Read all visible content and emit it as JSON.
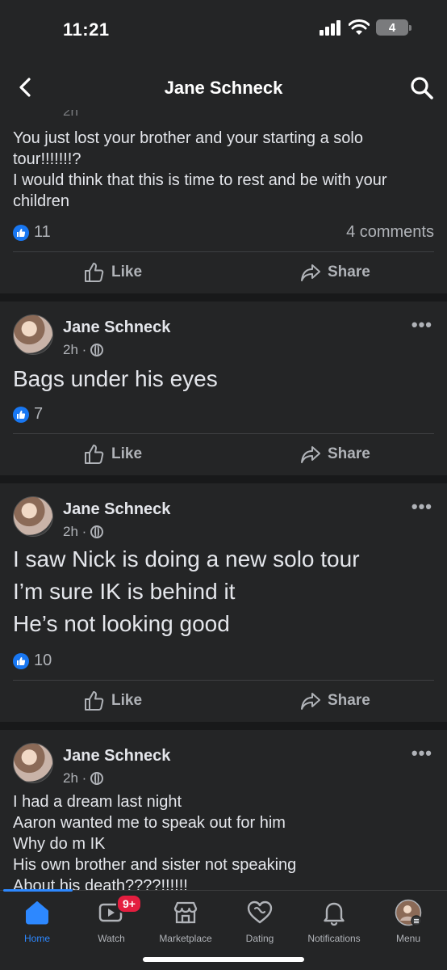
{
  "status_bar": {
    "time": "11:21",
    "battery": "4"
  },
  "header": {
    "title": "Jane Schneck"
  },
  "posts": [
    {
      "time": "2h",
      "lines": [
        "You just lost your brother and your starting a solo",
        "tour!!!!!!!?",
        "I would think that this is time to rest and be with your",
        "children"
      ],
      "likes": "11",
      "comments": "4 comments",
      "like_label": "Like",
      "share_label": "Share"
    },
    {
      "author": "Jane Schneck",
      "time": "2h ·",
      "lines": [
        "Bags under his eyes"
      ],
      "likes": "7",
      "like_label": "Like",
      "share_label": "Share"
    },
    {
      "author": "Jane Schneck",
      "time": "2h ·",
      "lines": [
        "I saw Nick is doing a new solo tour",
        "I’m sure IK is behind it",
        "He’s not looking good"
      ],
      "likes": "10",
      "like_label": "Like",
      "share_label": "Share"
    },
    {
      "author": "Jane Schneck",
      "time": "2h ·",
      "lines": [
        "I had a dream last night",
        "Aaron wanted me to speak out for him",
        "Why do m IK",
        "His own brother and sister not speaking",
        "About his death????!!!!!!"
      ]
    }
  ],
  "more_label": "•••",
  "tabs": [
    {
      "label": "Home",
      "icon": "home-icon"
    },
    {
      "label": "Watch",
      "icon": "watch-icon",
      "badge": "9+"
    },
    {
      "label": "Marketplace",
      "icon": "marketplace-icon"
    },
    {
      "label": "Dating",
      "icon": "dating-icon"
    },
    {
      "label": "Notifications",
      "icon": "bell-icon"
    },
    {
      "label": "Menu",
      "icon": "menu-avatar-icon"
    }
  ]
}
